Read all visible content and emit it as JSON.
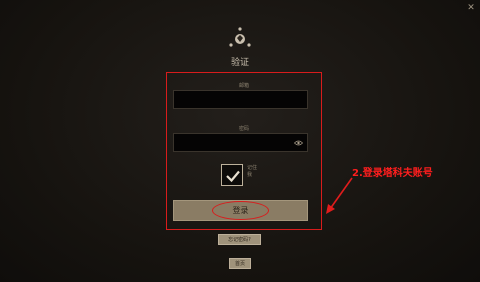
{
  "window": {
    "close_glyph": "✕"
  },
  "header": {
    "logo_icon": "emblem-icon",
    "title": "验证"
  },
  "form": {
    "email_label": "邮箱",
    "email_value": "",
    "password_label": "密码",
    "password_value": "",
    "show_password_icon": "eye-icon",
    "remember_label": "记住我",
    "remember_checked": true,
    "login_label": "登录",
    "forgot_label": "忘记密码?",
    "home_label": "首页"
  },
  "annotation": {
    "text": "2.登录塔科夫账号",
    "color": "#ff1e1e"
  },
  "colors": {
    "highlight": "#d81c1c",
    "button": "#8a7c64",
    "background": "#16130f"
  }
}
